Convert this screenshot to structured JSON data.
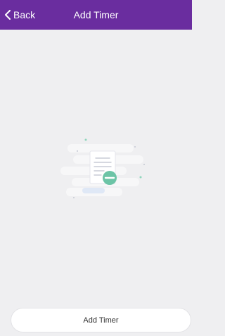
{
  "nav": {
    "back_label": "Back",
    "title": "Add Timer",
    "back_icon": "chevron-left-icon"
  },
  "empty_state": {
    "illustration_icon": "empty-document-icon"
  },
  "footer": {
    "add_timer_label": "Add Timer"
  },
  "colors": {
    "nav_background": "#6a2d9f",
    "page_background": "#efeff1",
    "accent_green": "#6cc4a6"
  }
}
